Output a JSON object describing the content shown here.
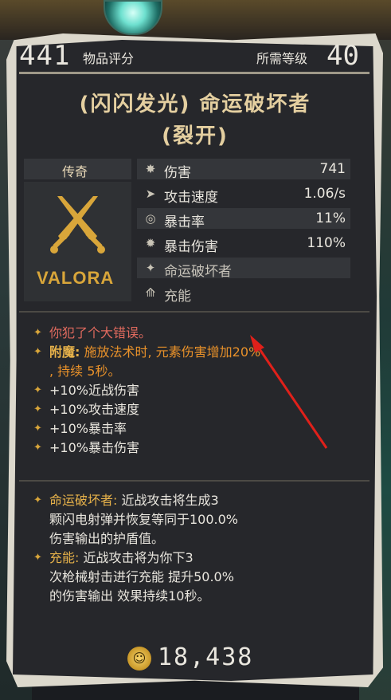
{
  "header": {
    "item_score": "441",
    "item_score_label": "物品评分",
    "required_level_label": "所需等级",
    "required_level": "40"
  },
  "title": {
    "line1": "(闪闪发光) 命运破坏者",
    "line2": "(裂开)"
  },
  "rarity": "传奇",
  "brand": "VALORA",
  "stats": [
    {
      "icon": "damage-icon",
      "label": "伤害",
      "value": "741"
    },
    {
      "icon": "attack-speed-icon",
      "label": "攻击速度",
      "value": "1.06/s"
    },
    {
      "icon": "crit-rate-icon",
      "label": "暴击率",
      "value": "11%"
    },
    {
      "icon": "crit-damage-icon",
      "label": "暴击伤害",
      "value": "110%"
    },
    {
      "icon": "fate-icon",
      "label": "命运破坏者",
      "value": ""
    },
    {
      "icon": "charge-icon",
      "label": "充能",
      "value": ""
    }
  ],
  "modifiers": {
    "mistake": "你犯了个大错误。",
    "enchant_label": "附魔:",
    "enchant_text": "施放法术时, 元素伤害增加20%",
    "enchant_text2": ", 持续 5秒。",
    "lines": [
      "+10%近战伤害",
      "+10%攻击速度",
      "+10%暴击率",
      "+10%暴击伤害"
    ]
  },
  "abilities": {
    "fate_label": "命运破坏者:",
    "fate_text1": "近战攻击将生成3",
    "fate_text2": "颗闪电射弹并恢复等同于100.0%",
    "fate_text3": "伤害输出的护盾值。",
    "charge_label": "充能:",
    "charge_text1": "近战攻击将为你下3",
    "charge_text2": "次枪械射击进行充能 提升50.0%",
    "charge_text3": "的伤害输出 效果持续10秒。"
  },
  "price": "18,438",
  "colors": {
    "gold": "#e7b24a",
    "orange": "#e8912a",
    "red": "#e06a5e",
    "arrow": "#e0201a"
  }
}
